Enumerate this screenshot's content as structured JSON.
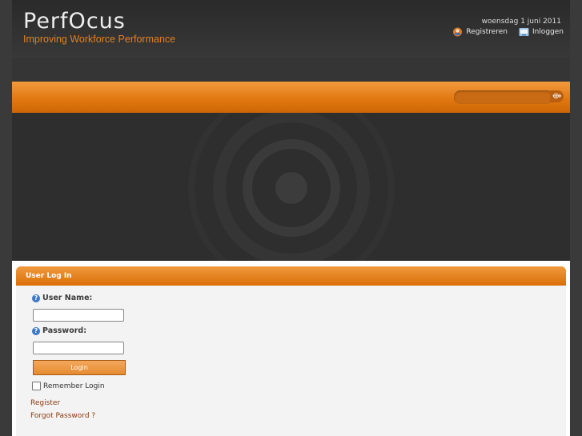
{
  "header": {
    "logo": "PERFOCUS",
    "logo_parts": [
      "Perf",
      "O",
      "cus"
    ],
    "tagline": "Improving Workforce Performance",
    "date": "woensdag 1 juni 2011",
    "links": [
      {
        "label": "Registreren",
        "icon": "register-icon"
      },
      {
        "label": "Inloggen",
        "icon": "login-icon"
      }
    ]
  },
  "search": {
    "value": "",
    "button_icon": "search-go-icon",
    "button_glyph": "⟴"
  },
  "login_panel": {
    "title": "User Log In",
    "username_label": "User Name:",
    "username_value": "",
    "password_label": "Password:",
    "password_value": "",
    "help_icon": "help-icon",
    "help_glyph": "?",
    "login_button": "Login",
    "remember_label": "Remember Login",
    "remember_checked": false,
    "register_link": "Register",
    "forgot_link": "Forgot Password ?"
  },
  "colors": {
    "accent": "#e07818",
    "background": "#2e2e2e",
    "link": "#8a3a10"
  }
}
